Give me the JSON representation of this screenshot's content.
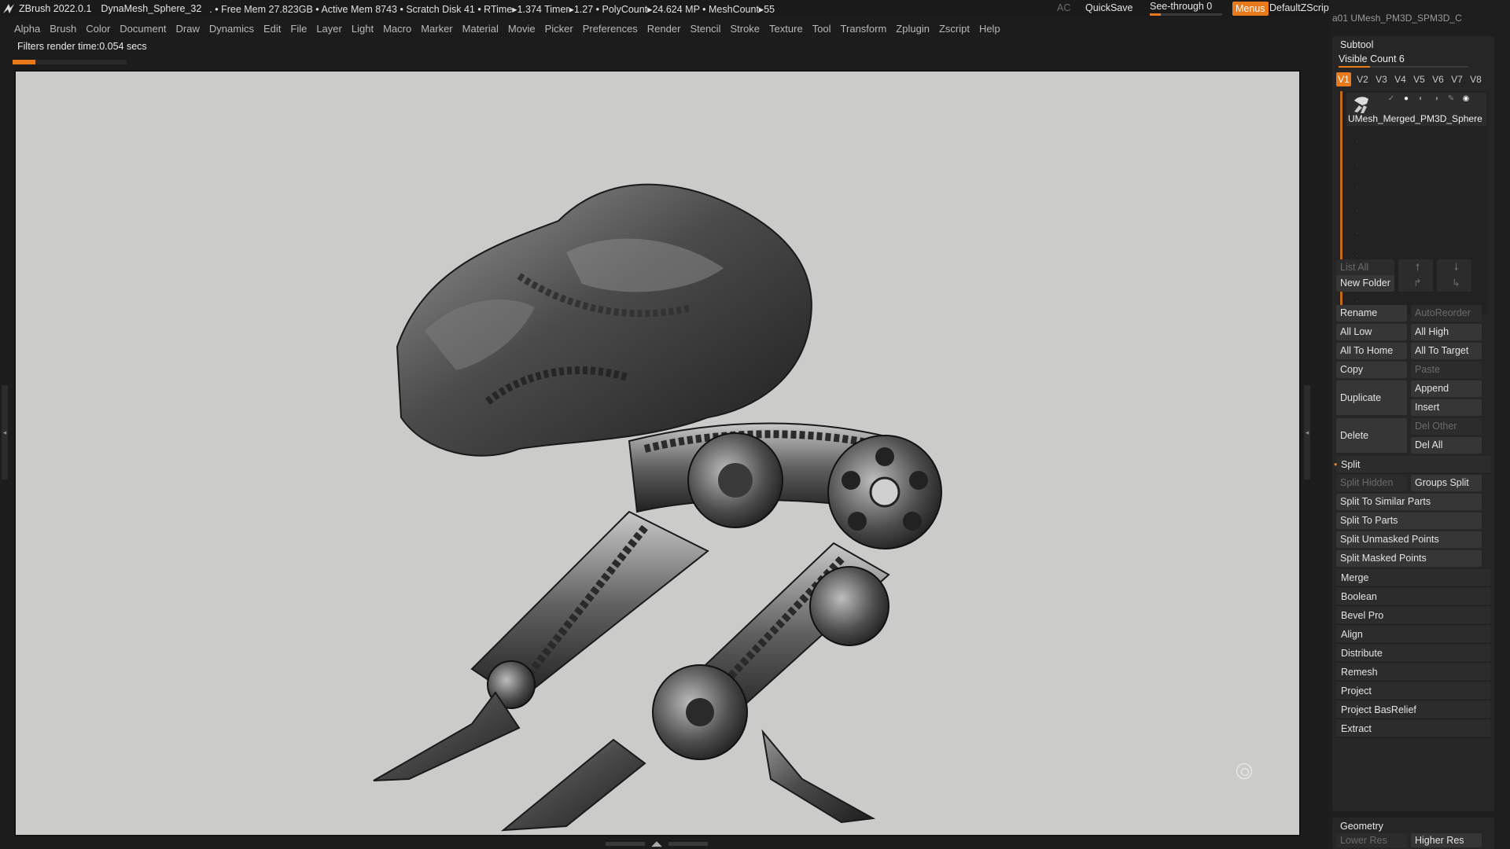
{
  "titlebar": {
    "app": "ZBrush 2022.0.1",
    "document": "DynaMesh_Sphere_32",
    "stats": ". • Free Mem 27.823GB • Active Mem 8743 • Scratch Disk 41 •  RTime▸1.374 Timer▸1.27 • PolyCount▸24.624 MP  • MeshCount▸55",
    "ac": "AC",
    "quicksave": "QuickSave",
    "seethrough": "See-through  0",
    "seethrough_value": 0,
    "menus": "Menus",
    "default_zscript": "DefaultZScript",
    "icons": [
      "layout-icon",
      "layout-2-icon",
      "copy-window-icon",
      "wide-window-icon",
      "minimize-icon",
      "restore-icon",
      "close-icon"
    ]
  },
  "menubar": {
    "items": [
      "Alpha",
      "Brush",
      "Color",
      "Document",
      "Draw",
      "Dynamics",
      "Edit",
      "File",
      "Layer",
      "Light",
      "Macro",
      "Marker",
      "Material",
      "Movie",
      "Picker",
      "Preferences",
      "Render",
      "Stencil",
      "Stroke",
      "Texture",
      "Tool",
      "Transform",
      "Zplugin",
      "Zscript",
      "Help"
    ]
  },
  "status": {
    "filters": "Filters render time:0.054 secs",
    "progress_fraction": 0.2
  },
  "tray": {
    "top_clip": "a01   UMesh_PM3D_SPM3D_C",
    "subtool": {
      "title": "Subtool",
      "visible_count": "Visible Count 6",
      "versions": [
        "V1",
        "V2",
        "V3",
        "V4",
        "V5",
        "V6",
        "V7",
        "V8"
      ],
      "active_version": "V1",
      "item_name": "UMesh_Merged_PM3D_Sphere",
      "list_all": "List All",
      "new_folder": "New Folder",
      "rename": "Rename",
      "autoreorder": "AutoReorder",
      "all_low": "All Low",
      "all_high": "All High",
      "all_to_home": "All To Home",
      "all_to_target": "All To Target",
      "copy": "Copy",
      "paste": "Paste",
      "duplicate": "Duplicate",
      "append": "Append",
      "insert": "Insert",
      "delete": "Delete",
      "del_other": "Del Other",
      "del_all": "Del All",
      "split": "Split",
      "split_hidden": "Split Hidden",
      "groups_split": "Groups Split",
      "split_similar": "Split To Similar Parts",
      "split_parts": "Split To Parts",
      "split_unmasked": "Split Unmasked Points",
      "split_masked": "Split Masked Points",
      "sections": [
        "Merge",
        "Boolean",
        "Bevel Pro",
        "Align",
        "Distribute",
        "Remesh",
        "Project",
        "Project BasRelief",
        "Extract"
      ]
    },
    "geometry": {
      "title": "Geometry",
      "lower_res": "Lower Res",
      "higher_res": "Higher Res"
    }
  },
  "viewport": {
    "background": "#cbcbca"
  }
}
